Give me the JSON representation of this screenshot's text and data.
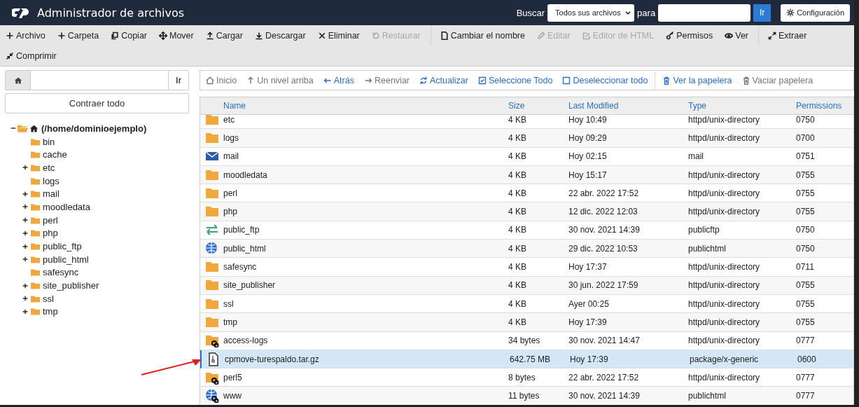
{
  "header": {
    "title": "Administrador de archivos",
    "search_label": "Buscar",
    "search_scope": "Todos sus archivos",
    "for_label": "para",
    "go_button": "Ir",
    "settings_button": "Configuración"
  },
  "toolbar": [
    {
      "label": "Archivo",
      "disabled": false,
      "divider_after": false
    },
    {
      "label": "Carpeta",
      "disabled": false,
      "divider_after": false
    },
    {
      "label": "Copiar",
      "disabled": false,
      "divider_after": false
    },
    {
      "label": "Mover",
      "disabled": false,
      "divider_after": false
    },
    {
      "label": "Cargar",
      "disabled": false,
      "divider_after": false
    },
    {
      "label": "Descargar",
      "disabled": false,
      "divider_after": false
    },
    {
      "label": "Eliminar",
      "disabled": false,
      "divider_after": false
    },
    {
      "label": "Restaurar",
      "disabled": true,
      "divider_after": true
    },
    {
      "label": "Cambiar el nombre",
      "disabled": false,
      "divider_after": false
    },
    {
      "label": "Editar",
      "disabled": true,
      "divider_after": false
    },
    {
      "label": "Editor de HTML",
      "disabled": true,
      "divider_after": false
    },
    {
      "label": "Permisos",
      "disabled": false,
      "divider_after": false
    },
    {
      "label": "Ver",
      "disabled": false,
      "divider_after": true
    },
    {
      "label": "Extraer",
      "disabled": false,
      "divider_after": false
    },
    {
      "label": "Comprimir",
      "disabled": false,
      "divider_after": false
    }
  ],
  "path_bar": {
    "go_button": "Ir"
  },
  "collapse_button": "Contraer todo",
  "tree": {
    "label": "(/home/dominioejemplo)",
    "expanded": true,
    "children": [
      {
        "label": "bin",
        "has_children": false
      },
      {
        "label": "cache",
        "has_children": false
      },
      {
        "label": "etc",
        "has_children": true
      },
      {
        "label": "logs",
        "has_children": false
      },
      {
        "label": "mail",
        "has_children": true
      },
      {
        "label": "moodledata",
        "has_children": true
      },
      {
        "label": "perl",
        "has_children": true
      },
      {
        "label": "php",
        "has_children": true
      },
      {
        "label": "public_ftp",
        "has_children": true
      },
      {
        "label": "public_html",
        "has_children": true
      },
      {
        "label": "safesync",
        "has_children": false
      },
      {
        "label": "site_publisher",
        "has_children": true
      },
      {
        "label": "ssl",
        "has_children": true
      },
      {
        "label": "tmp",
        "has_children": true
      }
    ]
  },
  "nav": [
    {
      "label": "Inicio",
      "disabled": true,
      "divider_after": false
    },
    {
      "label": "Un nivel arriba",
      "disabled": true,
      "divider_after": false
    },
    {
      "label": "Atrás",
      "disabled": false,
      "divider_after": false
    },
    {
      "label": "Reenviar",
      "disabled": true,
      "divider_after": false
    },
    {
      "label": "Actualizar",
      "disabled": false,
      "divider_after": false
    },
    {
      "label": "Seleccione Todo",
      "disabled": false,
      "divider_after": false
    },
    {
      "label": "Deseleccionar todo",
      "disabled": false,
      "divider_after": true
    },
    {
      "label": "Ver la papelera",
      "disabled": false,
      "divider_after": false
    },
    {
      "label": "Vaciar papelera",
      "disabled": true,
      "divider_after": false
    }
  ],
  "table": {
    "columns": [
      "Name",
      "Size",
      "Last Modified",
      "Type",
      "Permissions"
    ],
    "rows": [
      {
        "kind": "folder",
        "name": "etc",
        "size": "4 KB",
        "modified": "Hoy 10:49",
        "type": "httpd/unix-directory",
        "permissions": "0750",
        "selected": false
      },
      {
        "kind": "folder",
        "name": "logs",
        "size": "4 KB",
        "modified": "Hoy 09:29",
        "type": "httpd/unix-directory",
        "permissions": "0700",
        "selected": false
      },
      {
        "kind": "mail",
        "name": "mail",
        "size": "4 KB",
        "modified": "Hoy 02:15",
        "type": "mail",
        "permissions": "0751",
        "selected": false
      },
      {
        "kind": "folder",
        "name": "moodledata",
        "size": "4 KB",
        "modified": "Hoy 15:17",
        "type": "httpd/unix-directory",
        "permissions": "0755",
        "selected": false
      },
      {
        "kind": "folder",
        "name": "perl",
        "size": "4 KB",
        "modified": "22 abr. 2022 17:52",
        "type": "httpd/unix-directory",
        "permissions": "0755",
        "selected": false
      },
      {
        "kind": "folder",
        "name": "php",
        "size": "4 KB",
        "modified": "12 dic. 2022 12:03",
        "type": "httpd/unix-directory",
        "permissions": "0755",
        "selected": false
      },
      {
        "kind": "ftp",
        "name": "public_ftp",
        "size": "4 KB",
        "modified": "30 nov. 2021 14:39",
        "type": "publicftp",
        "permissions": "0750",
        "selected": false
      },
      {
        "kind": "web",
        "name": "public_html",
        "size": "4 KB",
        "modified": "29 dic. 2022 10:53",
        "type": "publichtml",
        "permissions": "0750",
        "selected": false
      },
      {
        "kind": "folder",
        "name": "safesync",
        "size": "4 KB",
        "modified": "Hoy 17:37",
        "type": "httpd/unix-directory",
        "permissions": "0711",
        "selected": false
      },
      {
        "kind": "folder",
        "name": "site_publisher",
        "size": "4 KB",
        "modified": "30 jun. 2022 17:59",
        "type": "httpd/unix-directory",
        "permissions": "0755",
        "selected": false
      },
      {
        "kind": "folder",
        "name": "ssl",
        "size": "4 KB",
        "modified": "Ayer 00:25",
        "type": "httpd/unix-directory",
        "permissions": "0755",
        "selected": false
      },
      {
        "kind": "folder",
        "name": "tmp",
        "size": "4 KB",
        "modified": "Hoy 17:39",
        "type": "httpd/unix-directory",
        "permissions": "0755",
        "selected": false
      },
      {
        "kind": "folder-link",
        "name": "access-logs",
        "size": "34 bytes",
        "modified": "30 nov. 2021 14:47",
        "type": "httpd/unix-directory",
        "permissions": "0777",
        "selected": false
      },
      {
        "kind": "archive",
        "name": "cpmove-turespaldo.tar.gz",
        "size": "642.75 MB",
        "modified": "Hoy 17:39",
        "type": "package/x-generic",
        "permissions": "0600",
        "selected": true
      },
      {
        "kind": "folder-link",
        "name": "perl5",
        "size": "8 bytes",
        "modified": "22 abr. 2022 17:52",
        "type": "httpd/unix-directory",
        "permissions": "0777",
        "selected": false
      },
      {
        "kind": "web-link",
        "name": "www",
        "size": "11 bytes",
        "modified": "30 nov. 2021 14:39",
        "type": "publichtml",
        "permissions": "0777",
        "selected": false
      }
    ]
  }
}
